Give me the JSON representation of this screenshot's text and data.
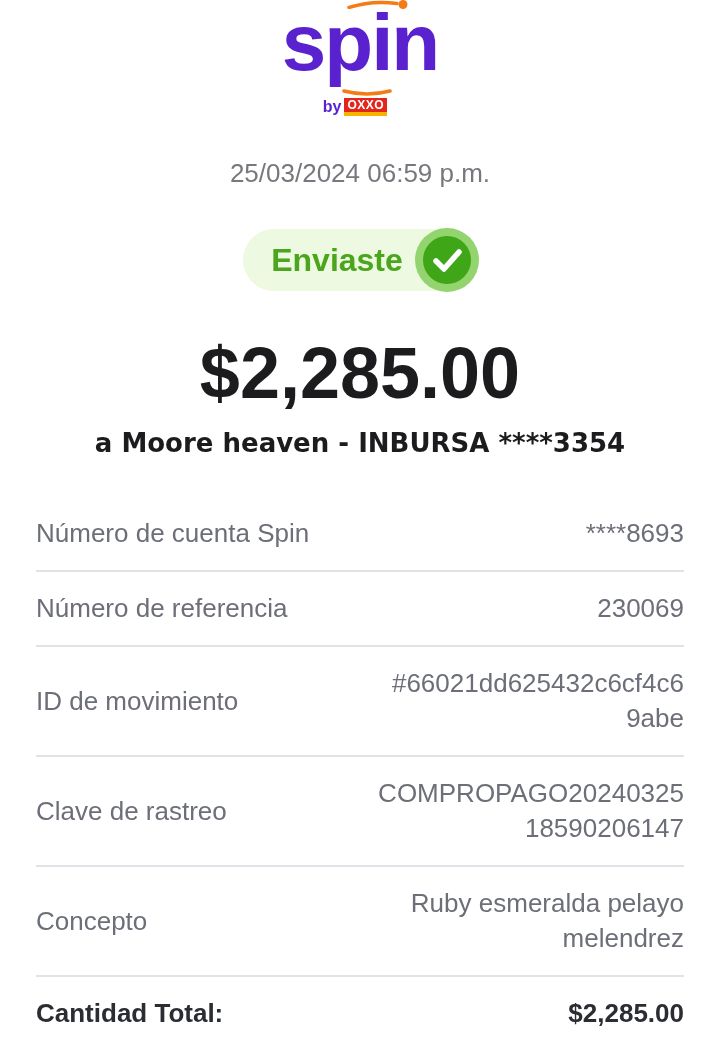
{
  "logo": {
    "wordmark": "spin",
    "by": "by",
    "partner": "OXXO"
  },
  "date": "25/03/2024 06:59 p.m.",
  "status": {
    "label": "Enviaste"
  },
  "amount": "$2,285.00",
  "recipient": "a Moore heaven - INBURSA ****3354",
  "details": [
    {
      "label": "Número de cuenta Spin",
      "value_lines": [
        "****8693"
      ]
    },
    {
      "label": "Número de referencia",
      "value_lines": [
        "230069"
      ]
    },
    {
      "label": "ID de movimiento",
      "value_lines": [
        "#66021dd625432c6cf4c6",
        "9abe"
      ]
    },
    {
      "label": "Clave de rastreo",
      "value_lines": [
        "COMPROPAGO20240325",
        "18590206147"
      ]
    },
    {
      "label": "Concepto",
      "value_lines": [
        "Ruby esmeralda pelayo",
        "melendrez"
      ]
    }
  ],
  "total": {
    "label": "Cantidad Total:",
    "value": "$2,285.00"
  }
}
